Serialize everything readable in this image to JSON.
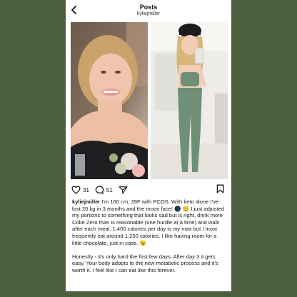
{
  "header": {
    "title": "Posts",
    "username": "kyliejmiller"
  },
  "post": {
    "likes": "31",
    "comments": "51",
    "caption_user": "kyliejmiller",
    "caption_paragraph_1": "I'm 160 cm, 39F with PCOS. With keto alone I've lost 20 kg in 3 months and the moon face! 🌑 😏 I just adjusted my portions to something that looks sad but is right, drink more Coke Zero than is reasonable (one hurdle at a time) and walk after each meal. 1,400 calories per day is my max but I most frequently eat around 1,250 calories. I like having room for a little chocolate, just in case. 😉",
    "caption_paragraph_2": "Honestly - it's only hard the first few days. After day 3 it gets easy. Your body adopts to the new metabolic process and it's worth it. I feel like I can eat like this forever."
  },
  "icons": {
    "back": "chevron-left-icon",
    "like": "heart-icon",
    "comment": "comment-bubble-icon",
    "share": "send-icon",
    "save": "bookmark-icon"
  },
  "colors": {
    "background": "#4b5e3d",
    "card": "#ffffff",
    "text": "#111111"
  }
}
